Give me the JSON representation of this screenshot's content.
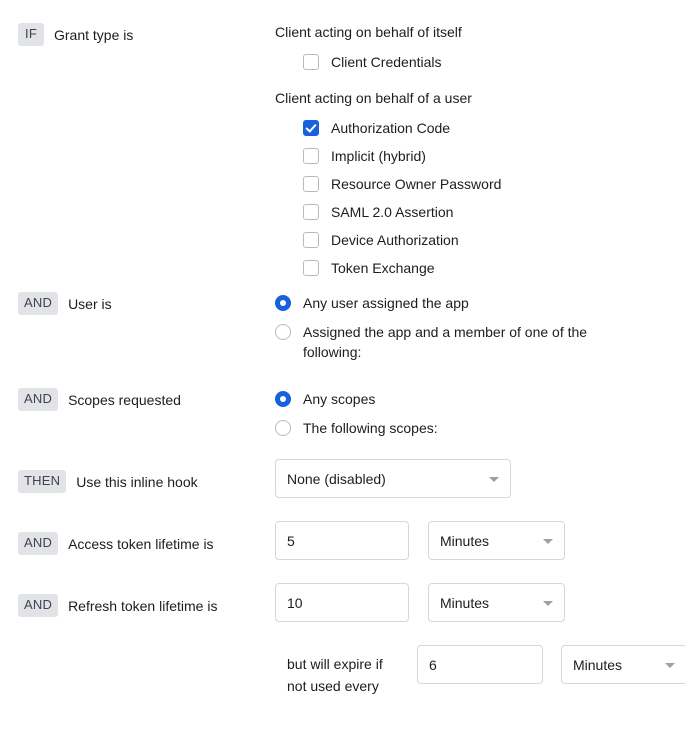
{
  "rules": {
    "grant_type": {
      "badge": "IF",
      "label": "Grant type is",
      "heading_self": "Client acting on behalf of itself",
      "heading_user": "Client acting on behalf of a user",
      "self_options": [
        {
          "label": "Client Credentials",
          "checked": false
        }
      ],
      "user_options": [
        {
          "label": "Authorization Code",
          "checked": true
        },
        {
          "label": "Implicit (hybrid)",
          "checked": false
        },
        {
          "label": "Resource Owner Password",
          "checked": false
        },
        {
          "label": "SAML 2.0 Assertion",
          "checked": false
        },
        {
          "label": "Device Authorization",
          "checked": false
        },
        {
          "label": "Token Exchange",
          "checked": false
        }
      ]
    },
    "user": {
      "badge": "AND",
      "label": "User is",
      "options": [
        {
          "label": "Any user assigned the app",
          "selected": true
        },
        {
          "label": "Assigned the app and a member of one of the following:",
          "selected": false
        }
      ]
    },
    "scopes": {
      "badge": "AND",
      "label": "Scopes requested",
      "options": [
        {
          "label": "Any scopes",
          "selected": true
        },
        {
          "label": "The following scopes:",
          "selected": false
        }
      ]
    },
    "inline_hook": {
      "badge": "THEN",
      "label": "Use this inline hook",
      "value": "None (disabled)"
    },
    "access_token": {
      "badge": "AND",
      "label": "Access token lifetime is",
      "value": "5",
      "unit": "Minutes"
    },
    "refresh_token": {
      "badge": "AND",
      "label": "Refresh token lifetime is",
      "value": "10",
      "unit": "Minutes",
      "expire_label_line1": "but will expire if",
      "expire_label_line2": "not used every",
      "expire_value": "6",
      "expire_unit": "Minutes"
    }
  },
  "colors": {
    "accent": "#1662dd",
    "badge_bg": "#e1e3e6",
    "badge_text": "#3f4350",
    "border": "#d5d7dc",
    "text": "#1d1d21"
  }
}
